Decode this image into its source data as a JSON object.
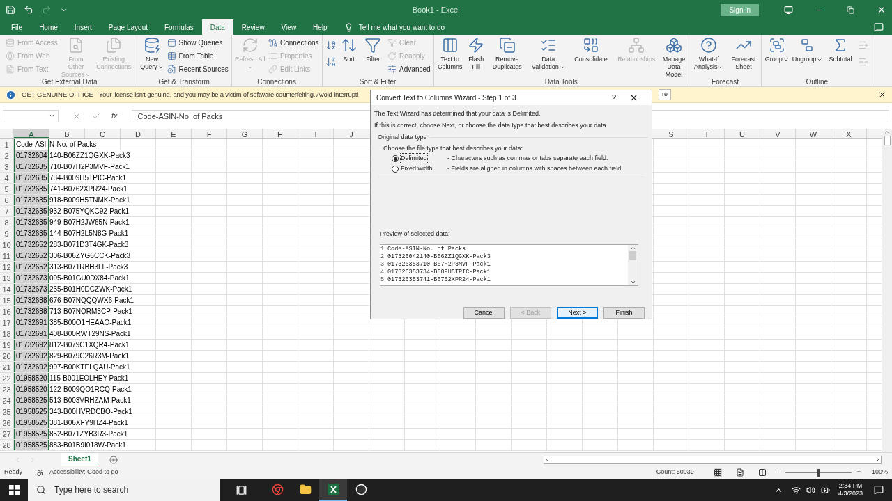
{
  "window": {
    "title": "Book1 - Excel",
    "sign_in": "Sign in"
  },
  "tabs": [
    {
      "label": "File",
      "selected": false
    },
    {
      "label": "Home",
      "selected": false
    },
    {
      "label": "Insert",
      "selected": false
    },
    {
      "label": "Page Layout",
      "selected": false
    },
    {
      "label": "Formulas",
      "selected": false
    },
    {
      "label": "Data",
      "selected": true
    },
    {
      "label": "Review",
      "selected": false
    },
    {
      "label": "View",
      "selected": false
    },
    {
      "label": "Help",
      "selected": false
    }
  ],
  "tell_me": "Tell me what you want to do",
  "ribbon": [
    {
      "label": "Get External Data",
      "items": [
        {
          "kind": "stack",
          "items": [
            {
              "label": "From Access",
              "disabled": true
            },
            {
              "label": "From Web",
              "disabled": true
            },
            {
              "label": "From Text",
              "disabled": true
            }
          ]
        },
        {
          "kind": "large",
          "label": "From Other Sources",
          "disabled": true,
          "dropdown": true
        },
        {
          "kind": "large",
          "label": "Existing Connections",
          "disabled": true,
          "dropdown": false
        }
      ]
    },
    {
      "label": "Get & Transform",
      "items": [
        {
          "kind": "large",
          "label": "New Query",
          "disabled": false,
          "dropdown": true
        },
        {
          "kind": "stack",
          "items": [
            {
              "label": "Show Queries",
              "disabled": false
            },
            {
              "label": "From Table",
              "disabled": false
            },
            {
              "label": "Recent Sources",
              "disabled": false
            }
          ]
        }
      ]
    },
    {
      "label": "Connections",
      "items": [
        {
          "kind": "large",
          "label": "Refresh All",
          "disabled": true,
          "dropdown": true
        },
        {
          "kind": "stack",
          "items": [
            {
              "label": "Connections",
              "disabled": false
            },
            {
              "label": "Properties",
              "disabled": true
            },
            {
              "label": "Edit Links",
              "disabled": true
            }
          ]
        }
      ]
    },
    {
      "label": "Sort & Filter",
      "items": [
        {
          "kind": "icons",
          "count_disabled": false
        },
        {
          "kind": "large",
          "label": "Sort",
          "disabled": false,
          "dropdown": false
        },
        {
          "kind": "large",
          "label": "Filter",
          "disabled": false,
          "dropdown": false
        },
        {
          "kind": "stack",
          "items": [
            {
              "label": "Clear",
              "disabled": true
            },
            {
              "label": "Reapply",
              "disabled": true
            },
            {
              "label": "Advanced",
              "disabled": false
            }
          ]
        }
      ]
    },
    {
      "label": "Data Tools",
      "items": [
        {
          "kind": "large",
          "label": "Text to Columns",
          "disabled": false,
          "dropdown": false
        },
        {
          "kind": "large",
          "label": "Flash Fill",
          "disabled": false,
          "dropdown": false
        },
        {
          "kind": "large",
          "label": "Remove Duplicates",
          "disabled": false,
          "dropdown": false
        },
        {
          "kind": "large",
          "label": "Data Validation",
          "disabled": false,
          "dropdown": true
        },
        {
          "kind": "large",
          "label": "Consolidate",
          "disabled": false,
          "dropdown": false
        },
        {
          "kind": "large",
          "label": "Relationships",
          "disabled": true,
          "dropdown": false
        },
        {
          "kind": "large",
          "label": "Manage Data Model",
          "disabled": false,
          "dropdown": false
        }
      ]
    },
    {
      "label": "Forecast",
      "items": [
        {
          "kind": "large",
          "label": "What-If Analysis",
          "disabled": false,
          "dropdown": true
        },
        {
          "kind": "large",
          "label": "Forecast Sheet",
          "disabled": false,
          "dropdown": false
        }
      ]
    },
    {
      "label": "Outline",
      "items": [
        {
          "kind": "large",
          "label": "Group",
          "disabled": false,
          "dropdown": true
        },
        {
          "kind": "large",
          "label": "Ungroup",
          "disabled": false,
          "dropdown": true
        },
        {
          "kind": "large",
          "label": "Subtotal",
          "disabled": false,
          "dropdown": false
        },
        {
          "kind": "icons",
          "count_disabled": true
        }
      ]
    }
  ],
  "message_bar": {
    "title": "GET GENUINE OFFICE",
    "text": "Your license isn't genuine, and you may be a victim of software counterfeiting. Avoid interrupti",
    "button": "re"
  },
  "formula_bar": {
    "fx": "fx",
    "value": "Code-ASIN-No. of Packs"
  },
  "columns_left": [
    {
      "label": "A",
      "selected": true
    },
    {
      "label": "B",
      "selected": false
    },
    {
      "label": "C",
      "selected": false
    },
    {
      "label": "D",
      "selected": false
    },
    {
      "label": "E",
      "selected": false
    },
    {
      "label": "F",
      "selected": false
    },
    {
      "label": "G",
      "selected": false
    },
    {
      "label": "H",
      "selected": false
    },
    {
      "label": "I",
      "selected": false
    },
    {
      "label": "J",
      "selected": false
    }
  ],
  "columns_right": [
    {
      "label": "S",
      "selected": false
    },
    {
      "label": "T",
      "selected": false
    },
    {
      "label": "U",
      "selected": false
    },
    {
      "label": "V",
      "selected": false
    },
    {
      "label": "W",
      "selected": false
    },
    {
      "label": "X",
      "selected": false
    }
  ],
  "rows": [
    {
      "number": "1",
      "column_a": "Code-ASI",
      "overflow": "N-No. of Packs"
    },
    {
      "number": "2",
      "column_a": "01732604",
      "overflow": "140-B06ZZ1QGXK-Pack3"
    },
    {
      "number": "3",
      "column_a": "01732635",
      "overflow": "710-B07H2P3MVF-Pack1"
    },
    {
      "number": "4",
      "column_a": "01732635",
      "overflow": "734-B009H5TPIC-Pack1"
    },
    {
      "number": "5",
      "column_a": "01732635",
      "overflow": "741-B0762XPR24-Pack1"
    },
    {
      "number": "6",
      "column_a": "01732635",
      "overflow": "918-B009H5TNMK-Pack1"
    },
    {
      "number": "7",
      "column_a": "01732635",
      "overflow": "932-B075YQKC92-Pack1"
    },
    {
      "number": "8",
      "column_a": "01732635",
      "overflow": "949-B07H2JW65N-Pack1"
    },
    {
      "number": "9",
      "column_a": "01732635",
      "overflow": "144-B07H2L5N8G-Pack1"
    },
    {
      "number": "10",
      "column_a": "01732652",
      "overflow": "283-B071D3T4GK-Pack3"
    },
    {
      "number": "11",
      "column_a": "01732652",
      "overflow": "306-B06ZYG6CCK-Pack3"
    },
    {
      "number": "12",
      "column_a": "01732652",
      "overflow": "313-B071RBH3LL-Pack3"
    },
    {
      "number": "13",
      "column_a": "01732673",
      "overflow": "095-B01GU0DX84-Pack1"
    },
    {
      "number": "14",
      "column_a": "01732673",
      "overflow": "255-B01H0DCZWK-Pack1"
    },
    {
      "number": "15",
      "column_a": "01732688",
      "overflow": "676-B07NQQQWX6-Pack1"
    },
    {
      "number": "16",
      "column_a": "01732688",
      "overflow": "713-B07NQRM3CP-Pack1"
    },
    {
      "number": "17",
      "column_a": "01732691",
      "overflow": "385-B00O1HEAAO-Pack1"
    },
    {
      "number": "18",
      "column_a": "01732691",
      "overflow": "408-B00RWT29NS-Pack1"
    },
    {
      "number": "19",
      "column_a": "01732692",
      "overflow": "812-B079C1XQR4-Pack1"
    },
    {
      "number": "20",
      "column_a": "01732692",
      "overflow": "829-B079C26R3M-Pack1"
    },
    {
      "number": "21",
      "column_a": "01732692",
      "overflow": "997-B00KTELQAU-Pack1"
    },
    {
      "number": "22",
      "column_a": "01958520",
      "overflow": "115-B001EOLHEY-Pack1"
    },
    {
      "number": "23",
      "column_a": "01958520",
      "overflow": "122-B009QO1RCQ-Pack1"
    },
    {
      "number": "24",
      "column_a": "01958525",
      "overflow": "513-B003VRHZAM-Pack1"
    },
    {
      "number": "25",
      "column_a": "01958525",
      "overflow": "343-B00HVRDCBO-Pack1"
    },
    {
      "number": "26",
      "column_a": "01958525",
      "overflow": "381-B06XFY9HZ4-Pack1"
    },
    {
      "number": "27",
      "column_a": "01958525",
      "overflow": "852-B071ZYB3R3-Pack1"
    },
    {
      "number": "28",
      "column_a": "01958525",
      "overflow": "883-B01B9I018W-Pack1"
    }
  ],
  "dialog": {
    "title": "Convert Text to Columns Wizard - Step 1 of 3",
    "help": "?",
    "intro": "The Text Wizard has determined that your data is Delimited.",
    "instruction": "If this is correct, choose Next, or choose the data type that best describes your data.",
    "group_label": "Original data type",
    "prompt": "Choose the file type that best describes your data:",
    "options": [
      {
        "label": "Delimited",
        "description": "- Characters such as commas or tabs separate each field.",
        "selected": true
      },
      {
        "label": "Fixed width",
        "description": "- Fields are aligned in columns with spaces between each field.",
        "selected": false
      }
    ],
    "preview_label": "Preview of selected data:",
    "preview": [
      {
        "number": "1",
        "text": "Code-ASIN-No. of Packs"
      },
      {
        "number": "2",
        "text": "017326042140-B06ZZ1QGXK-Pack3"
      },
      {
        "number": "3",
        "text": "017326353710-B07H2P3MVF-Pack1"
      },
      {
        "number": "4",
        "text": "017326353734-B009H5TPIC-Pack1"
      },
      {
        "number": "5",
        "text": "017326353741-B0762XPR24-Pack1"
      }
    ],
    "buttons": [
      {
        "label": "Cancel",
        "disabled": false,
        "default": false
      },
      {
        "label": "< Back",
        "disabled": true,
        "default": false
      },
      {
        "label": "Next >",
        "disabled": false,
        "default": true
      },
      {
        "label": "Finish",
        "disabled": false,
        "default": false
      }
    ]
  },
  "sheet_tabs": [
    {
      "label": "Sheet1",
      "selected": true
    }
  ],
  "status_bar": {
    "ready": "Ready",
    "accessibility": "Accessibility: Good to go",
    "count": "Count: 50039",
    "zoom_minus": "-",
    "zoom_plus": "+",
    "zoom": "100%",
    "zoom_slider": {
      "level": 0.5
    }
  },
  "taskbar": {
    "search_placeholder": "Type here to search",
    "apps": [
      {
        "selected": false
      },
      {
        "selected": false
      },
      {
        "selected": true
      },
      {
        "selected": false
      }
    ],
    "time": "2:34 PM",
    "date": "4/3/2023"
  }
}
